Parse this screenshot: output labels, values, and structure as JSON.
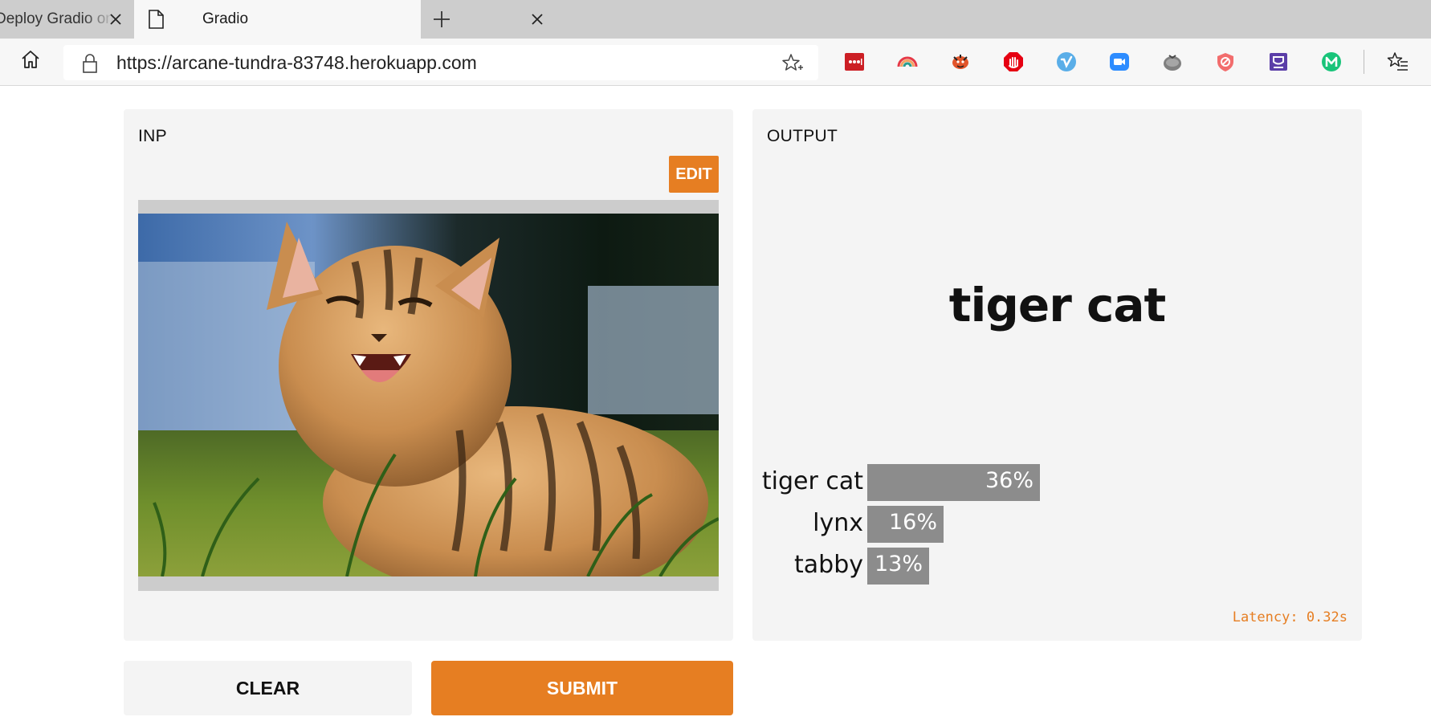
{
  "browser": {
    "tabs": [
      {
        "title": "Deploy Gradio on",
        "active": false
      },
      {
        "title": "Gradio",
        "active": true
      }
    ],
    "url": "https://arcane-tundra-83748.herokuapp.com",
    "extensions": [
      {
        "name": "lastpass-icon",
        "color": "#cc1f25"
      },
      {
        "name": "rainbow-icon",
        "color": "#3b82f6"
      },
      {
        "name": "fish-icon",
        "color": "#e2552b"
      },
      {
        "name": "adblock-icon",
        "color": "#e60012"
      },
      {
        "name": "vimeo-icon",
        "color": "#5aaee8"
      },
      {
        "name": "zoom-icon",
        "color": "#2d8cff"
      },
      {
        "name": "tomato-icon",
        "color": "#808080"
      },
      {
        "name": "shield-icon",
        "color": "#f26d6d"
      },
      {
        "name": "flag-icon",
        "color": "#5b3ea8"
      },
      {
        "name": "m-icon",
        "color": "#19c47a"
      }
    ]
  },
  "input_panel": {
    "title": "INP",
    "edit_label": "EDIT"
  },
  "output_panel": {
    "title": "OUTPUT",
    "prediction": "tiger cat",
    "confidences": [
      {
        "label": "tiger cat",
        "value": 0.36,
        "display": "36%"
      },
      {
        "label": "lynx",
        "value": 0.16,
        "display": "16%"
      },
      {
        "label": "tabby",
        "value": 0.13,
        "display": "13%"
      }
    ],
    "latency": "Latency: 0.32s"
  },
  "actions": {
    "clear_label": "CLEAR",
    "submit_label": "SUBMIT"
  },
  "colors": {
    "accent": "#e67e22",
    "bar": "#8c8c8c",
    "panel_bg": "#f4f4f4"
  }
}
